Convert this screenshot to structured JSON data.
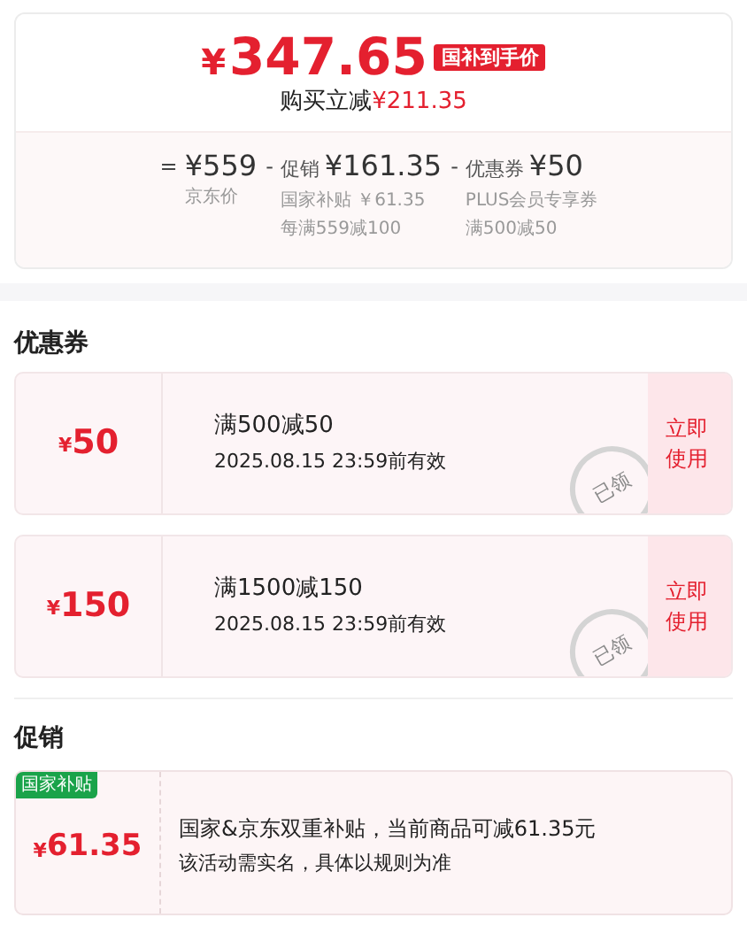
{
  "price_card": {
    "currency": "¥",
    "price": "347.65",
    "tag": "国补到手价",
    "savings_label": "购买立减",
    "savings_amount": "¥211.35",
    "breakdown": [
      {
        "operator": "=",
        "amount": "¥559",
        "notes": [
          "京东价"
        ]
      },
      {
        "operator": "-",
        "label": "促销",
        "amount": "¥161.35",
        "notes": [
          "国家补贴 ￥61.35",
          "每满559减100"
        ]
      },
      {
        "operator": "-",
        "label": "优惠券",
        "amount": "¥50",
        "notes": [
          "PLUS会员专享券",
          "满500减50"
        ]
      }
    ]
  },
  "coupons": {
    "title": "优惠券",
    "items": [
      {
        "currency": "¥",
        "amount": "50",
        "condition": "满500减50",
        "validity": "2025.08.15 23:59前有效",
        "stamp": "已领",
        "button": "立即使用"
      },
      {
        "currency": "¥",
        "amount": "150",
        "condition": "满1500减150",
        "validity": "2025.08.15 23:59前有效",
        "stamp": "已领",
        "button": "立即使用"
      }
    ]
  },
  "promotions": {
    "title": "促销",
    "items": [
      {
        "tag": "国家补贴",
        "currency": "¥",
        "amount": "61.35",
        "lines": [
          "国家&京东双重补贴，当前商品可减61.35元",
          "该活动需实名，具体以规则为准"
        ]
      }
    ]
  }
}
